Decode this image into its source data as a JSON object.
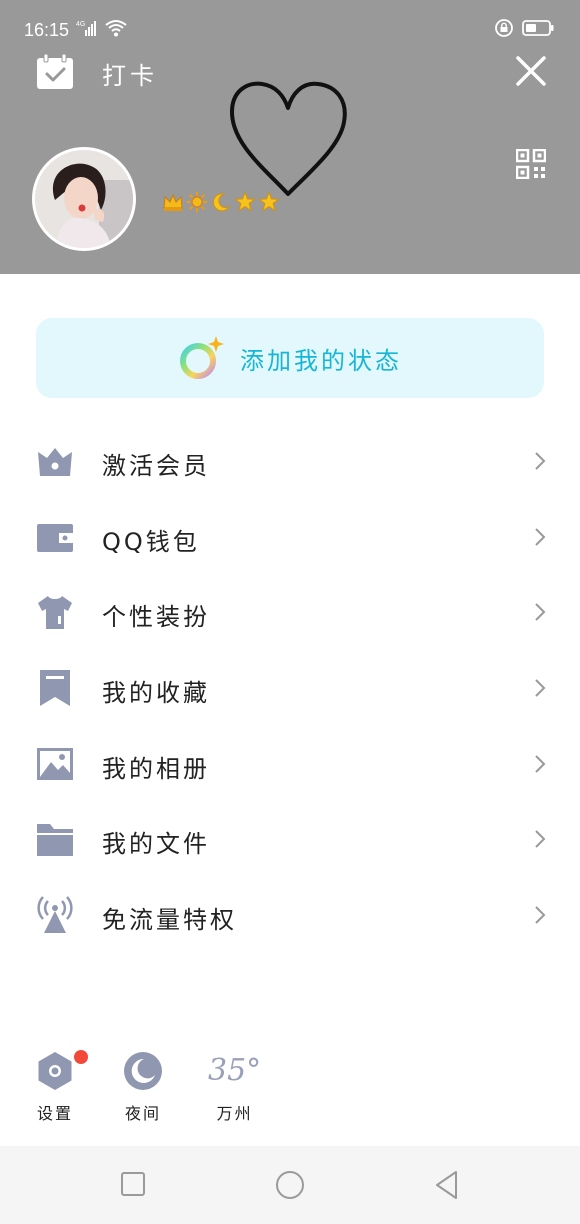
{
  "status_bar": {
    "time": "16:15",
    "icons": [
      "4g-signal-icon",
      "wifi-icon",
      "lock-rotation-icon",
      "battery-icon"
    ]
  },
  "header": {
    "checkin_label": "打卡",
    "background_color": "#999999",
    "icons": [
      "calendar-check-icon",
      "close-icon",
      "qr-code-icon",
      "heart-doodle-icon"
    ],
    "badges": [
      "crown-icon",
      "sun-icon",
      "moon-icon",
      "star-icon",
      "star-icon"
    ]
  },
  "status_button": {
    "label": "添加我的状态",
    "text_color": "#18b6d6",
    "background": "#e3f8fc"
  },
  "menu": {
    "icon_color": "#9097b0",
    "items": [
      {
        "label": "激活会员",
        "icon": "crown-icon"
      },
      {
        "label": "QQ钱包",
        "icon": "wallet-icon"
      },
      {
        "label": "个性装扮",
        "icon": "shirt-icon"
      },
      {
        "label": "我的收藏",
        "icon": "bookmark-icon"
      },
      {
        "label": "我的相册",
        "icon": "picture-icon"
      },
      {
        "label": "我的文件",
        "icon": "folder-icon"
      },
      {
        "label": "免流量特权",
        "icon": "antenna-icon"
      }
    ]
  },
  "bottom": {
    "settings_label": "设置",
    "night_label": "夜间",
    "weather_temp": "35°",
    "weather_city": "万州",
    "notification_dot_color": "#f24a3a"
  }
}
